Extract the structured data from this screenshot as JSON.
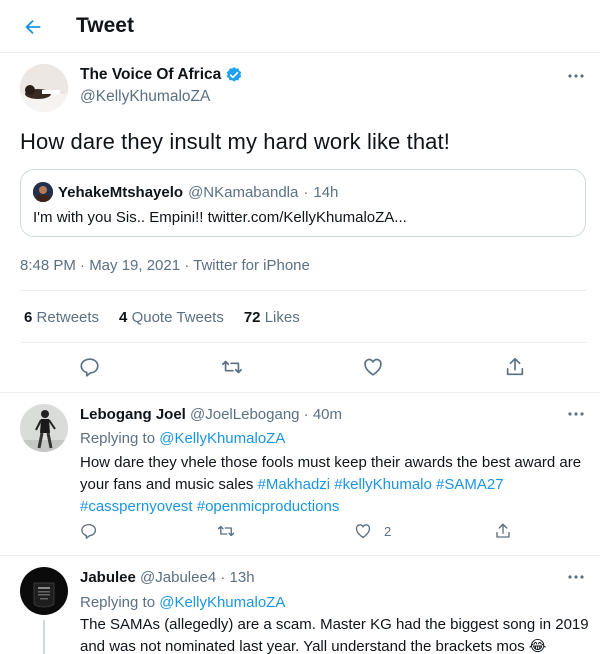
{
  "header": {
    "title": "Tweet",
    "back_icon": "arrow-left-icon"
  },
  "tweet": {
    "author_name": "The Voice Of Africa",
    "author_handle": "@KellyKhumaloZA",
    "verified_icon": "verified-badge-icon",
    "text": "How dare they insult my hard work like that!",
    "quote": {
      "name": "YehakeMtshayelo",
      "handle": "@NKamabandla",
      "sep": "·",
      "time": "14h",
      "text": "I'm with you Sis.. Empini!! twitter.com/KellyKhumaloZA..."
    },
    "meta": "8:48 PM · May 19, 2021 · Twitter for iPhone",
    "stats": {
      "retweets_count": "6",
      "retweets_label": "Retweets",
      "quotes_count": "4",
      "quotes_label": "Quote Tweets",
      "likes_count": "72",
      "likes_label": "Likes"
    }
  },
  "replies": [
    {
      "name": "Lebogang Joel",
      "handle": "@JoelLebogang",
      "sep": "·",
      "time": "40m",
      "replying_prefix": "Replying to",
      "replying_to": "@KellyKhumaloZA",
      "text_line1": "How dare they vhele those fools must keep their awards the best award are",
      "text_line2_plain": "your fans and music sales ",
      "text_line2_tags": "#Makhadzi #kellyKhumalo #SAMA27",
      "text_line3_tags": "#casspernyovest #openmicproductions",
      "likes": "2"
    },
    {
      "name": "Jabulee",
      "handle": "@Jabulee4",
      "sep": "·",
      "time": "13h",
      "replying_prefix": "Replying to",
      "replying_to": "@KellyKhumaloZA",
      "text_line1": "The SAMAs (allegedly) are a scam. Master KG had the biggest song in 2019",
      "text_line2": "and was not nominated last year. Yall understand the brackets mos",
      "emoji": "😂"
    }
  ],
  "colors": {
    "accent": "#1b95e0",
    "secondary_text": "#5b7083",
    "border": "#ebeef0"
  }
}
